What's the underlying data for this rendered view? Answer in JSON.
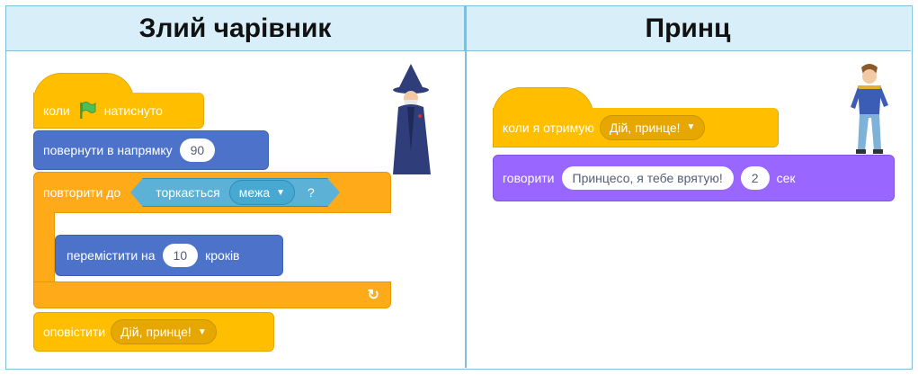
{
  "headers": {
    "left": "Злий чарівник",
    "right": "Принц"
  },
  "wizard_script": {
    "when_flag": {
      "prefix": "коли",
      "suffix": "натиснуто",
      "icon": "green-flag-icon"
    },
    "point": {
      "label": "повернути в напрямку",
      "value": "90"
    },
    "repeat_until": {
      "label": "повторити до"
    },
    "touching": {
      "label": "торкається",
      "option": "межа",
      "q": "?"
    },
    "move": {
      "label": "перемістити на",
      "value": "10",
      "suffix": "кроків"
    },
    "loop_arrow": "↻",
    "broadcast": {
      "label": "оповістити",
      "option": "Дій, принце!"
    }
  },
  "prince_script": {
    "when_receive": {
      "label": "коли я отримую",
      "option": "Дій, принце!"
    },
    "say": {
      "label": "говорити",
      "text": "Принцесо, я тебе врятую!",
      "secs": "2",
      "unit": "сек"
    }
  },
  "colors": {
    "events": "#ffbf00",
    "motion": "#4c73c9",
    "control": "#ffab19",
    "looks": "#9966ff",
    "sensing": "#5cb1d6",
    "header_bg": "#d8eef8",
    "border": "#7fbfdc"
  }
}
